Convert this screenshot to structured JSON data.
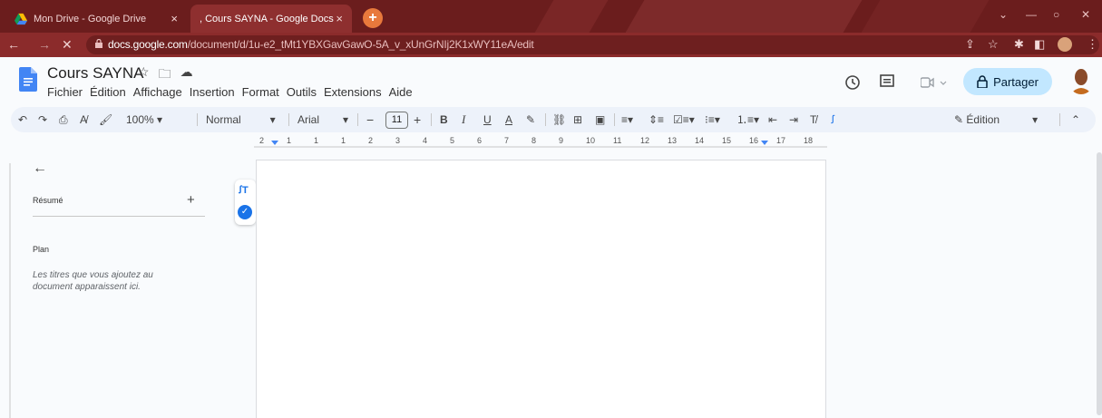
{
  "browser": {
    "tabs": [
      {
        "title": "Mon Drive - Google Drive",
        "close": "×"
      },
      {
        "title": ", Cours SAYNA - Google Docs",
        "close": "×"
      }
    ],
    "new_tab_label": "+",
    "nav": {
      "back": "←",
      "forward": "→",
      "stop": "✕"
    },
    "url_domain": "docs.google.com",
    "url_path": "/document/d/1u-e2_tMt1YBXGavGawO-5A_v_xUnGrNIj2K1xWY11eA/edit",
    "window_controls": {
      "minimize": "—",
      "maximize": "○",
      "close": "✕"
    },
    "colors": {
      "frame": "#6b1d1d",
      "toolbar": "#8b2b2b",
      "newtab": "#e8793c"
    }
  },
  "docs": {
    "title": "Cours SAYNA",
    "title_icons": [
      "star-icon",
      "folder-move-icon",
      "cloud-status-icon"
    ],
    "menu": [
      "Fichier",
      "Édition",
      "Affichage",
      "Insertion",
      "Format",
      "Outils",
      "Extensions",
      "Aide"
    ],
    "share_label": "Partager",
    "colors": {
      "share_bg": "#c2e7ff",
      "logo": "#4285f4"
    }
  },
  "toolbar": {
    "zoom": "100%",
    "style": "Normal",
    "font": "Arial",
    "font_size": "11",
    "minus": "−",
    "plus": "+",
    "bold": "B",
    "italic": "I",
    "underline": "U",
    "text_color": "A",
    "mode": "Édition"
  },
  "ruler": {
    "numbers": [
      "2",
      "1",
      "1",
      "1",
      "2",
      "3",
      "4",
      "5",
      "6",
      "7",
      "8",
      "9",
      "10",
      "11",
      "12",
      "13",
      "14",
      "15",
      "16",
      "17",
      "18"
    ]
  },
  "outline": {
    "summary_label": "Résumé",
    "add_label": "+",
    "plan_label": "Plan",
    "plan_hint": "Les titres que vous ajoutez au document apparaissent ici."
  }
}
